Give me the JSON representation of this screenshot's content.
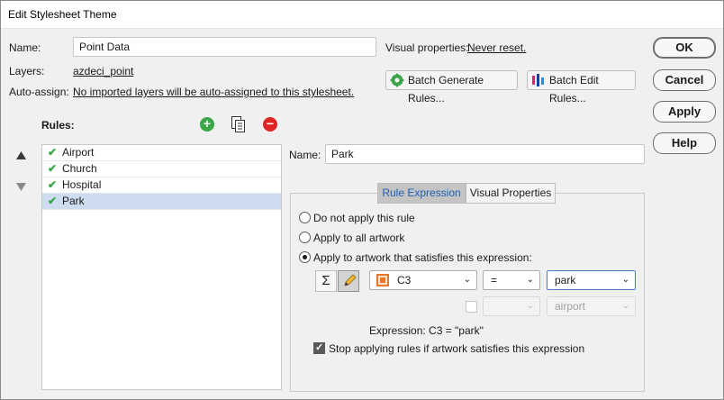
{
  "window": {
    "title": "Edit Stylesheet Theme"
  },
  "form": {
    "name_label": "Name:",
    "name_value": "Point Data",
    "layers_label": "Layers:",
    "layers_link": "azdeci_point",
    "autoassign_label": "Auto-assign:",
    "autoassign_link": "No imported layers will be auto-assigned to this stylesheet.",
    "visual_props_label": "Visual properties:",
    "visual_props_link": "Never reset."
  },
  "toolbar": {
    "batch_generate": "Batch Generate Rules...",
    "batch_edit": "Batch Edit Rules..."
  },
  "buttons": {
    "ok": "OK",
    "cancel": "Cancel",
    "apply": "Apply",
    "help": "Help"
  },
  "rules": {
    "label": "Rules:",
    "items": [
      {
        "label": "Airport"
      },
      {
        "label": "Church"
      },
      {
        "label": "Hospital"
      },
      {
        "label": "Park"
      }
    ],
    "selected": "Park"
  },
  "rule_detail": {
    "name_label": "Name:",
    "name_value": "Park",
    "tabs": [
      {
        "label": "Rule Expression"
      },
      {
        "label": "Visual Properties"
      }
    ],
    "options": {
      "none": "Do not apply this rule",
      "all": "Apply to all artwork",
      "expr": "Apply to artwork that satisfies this expression:"
    },
    "selected_option": "expr",
    "field_value": "C3",
    "operator_value": "=",
    "operand_value": "park",
    "second_operator_value": "",
    "second_operand_placeholder": "airport",
    "expression_text": "Expression: C3 = \"park\"",
    "stop_label": "Stop applying rules if artwork satisfies this expression",
    "stop_checked": true
  },
  "icons": {
    "sigma": "Σ",
    "check": "✔",
    "chevron_down": "⌄"
  },
  "colors": {
    "add": "#3aa648",
    "remove": "#e02424",
    "field_icon": "#e8782b",
    "active_tab_text": "#1a5fb4"
  }
}
